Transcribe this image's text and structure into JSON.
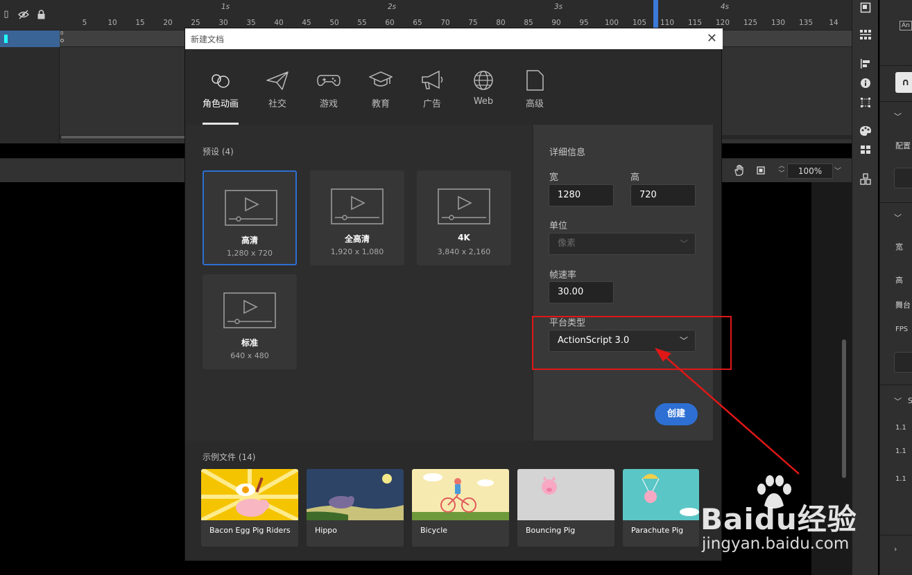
{
  "timeline": {
    "second_markers": [
      "1s",
      "2s",
      "3s",
      "4s"
    ],
    "frame_numbers": [
      "5",
      "10",
      "15",
      "20",
      "25",
      "30",
      "35",
      "40",
      "45",
      "50",
      "55",
      "60",
      "65",
      "70",
      "75",
      "80",
      "85",
      "90",
      "95",
      "100",
      "105",
      "110",
      "115",
      "120",
      "125",
      "130",
      "135",
      "14"
    ],
    "frame_zero": "0"
  },
  "stage_toolbar": {
    "zoom": "100%"
  },
  "props_panel": {
    "badge": "An",
    "row_labels": [
      "配置",
      "宽",
      "高",
      "舞台",
      "FPS",
      "1.1",
      "1.1",
      "1.1"
    ],
    "section_letters": [
      "S"
    ]
  },
  "dialog": {
    "title": "新建文档",
    "categories": [
      {
        "label": "角色动画",
        "icon": "character-animation-icon",
        "active": true
      },
      {
        "label": "社交",
        "icon": "paper-plane-icon"
      },
      {
        "label": "游戏",
        "icon": "gamepad-icon"
      },
      {
        "label": "教育",
        "icon": "graduation-cap-icon"
      },
      {
        "label": "广告",
        "icon": "megaphone-icon"
      },
      {
        "label": "Web",
        "icon": "globe-icon"
      },
      {
        "label": "高级",
        "icon": "document-icon"
      }
    ],
    "presets_heading": "预设 (4)",
    "presets": [
      {
        "name": "高清",
        "size": "1,280 x 720",
        "selected": true
      },
      {
        "name": "全高清",
        "size": "1,920 x 1,080"
      },
      {
        "name": "4K",
        "size": "3,840 x 2,160"
      },
      {
        "name": "标准",
        "size": "640 x 480"
      }
    ],
    "details": {
      "heading": "详细信息",
      "width_label": "宽",
      "width_value": "1280",
      "height_label": "高",
      "height_value": "720",
      "unit_label": "单位",
      "unit_value": "像素",
      "fps_label": "帧速率",
      "fps_value": "30.00",
      "platform_label": "平台类型",
      "platform_value": "ActionScript 3.0",
      "create_label": "创建"
    },
    "samples_heading": "示例文件 (14)",
    "samples": [
      {
        "name": "Bacon Egg Pig Riders"
      },
      {
        "name": "Hippo"
      },
      {
        "name": "Bicycle"
      },
      {
        "name": "Bouncing Pig"
      },
      {
        "name": "Parachute Pig"
      }
    ]
  },
  "watermark": {
    "brand": "Baidu经验",
    "url": "jingyan.baidu.com"
  },
  "colors": {
    "accent": "#2d6fd3",
    "annotation": "#e01717",
    "playhead": "#3c78d8"
  }
}
